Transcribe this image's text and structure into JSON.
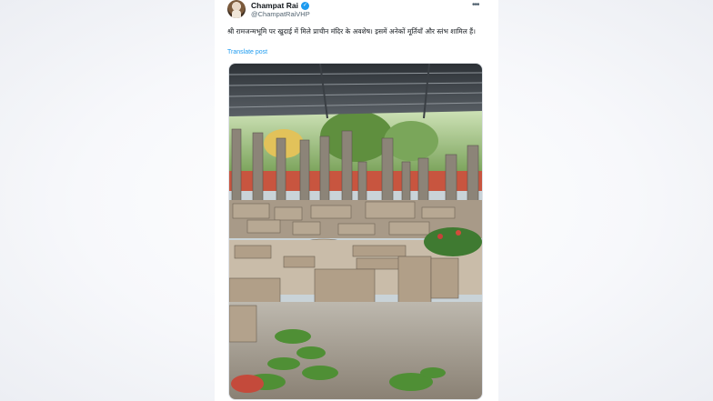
{
  "post": {
    "author_name": "Champat Rai",
    "author_handle": "@ChampatRaiVHP",
    "more_icon": "more-horizontal-icon",
    "verified_icon": "verified-badge-icon",
    "text": "श्री रामजन्मभूमि पर खुदाई में मिले प्राचीन मंदिर के अवशेष। इसमें अनेकों मूर्तियाँ और स्तंभ शामिल हैं।",
    "translate_label": "Translate post"
  },
  "colors": {
    "accent": "#1d9bf0",
    "text_primary": "#0f1419",
    "text_secondary": "#536471"
  }
}
